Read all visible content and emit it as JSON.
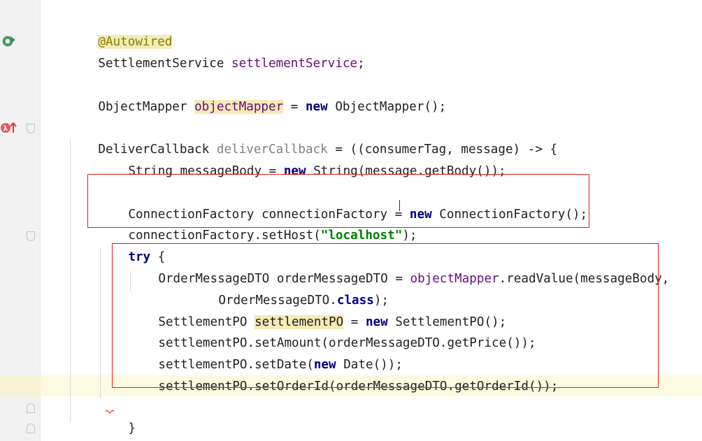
{
  "editor": {
    "line1": {
      "t0": "@Autowired"
    },
    "line2": {
      "t0": "SettlementService ",
      "t1": "settlementService",
      "t2": ";"
    },
    "line4": {
      "t0": "ObjectMapper ",
      "t1": "objectMapper",
      "t2": " = ",
      "t3": "new",
      "t4": " ObjectMapper();"
    },
    "line6": {
      "t0": "DeliverCallback ",
      "t1": "deliverCallback",
      "t2": " = ((consumerTag, message) -> {"
    },
    "line7": {
      "t0": "String messageBody = ",
      "t1": "new",
      "t2": " String(message.getBody());"
    },
    "line9": {
      "t0": "ConnectionFactory connectionFactory = ",
      "t1": "new",
      "t2": " ConnectionFactory();"
    },
    "line10": {
      "t0": "connectionFactory.setHost(",
      "t1": "\"localhost\"",
      "t2": ");"
    },
    "line11": {
      "t0": "try",
      "t1": " {"
    },
    "line12": {
      "t0": "OrderMessageDTO orderMessageDTO = ",
      "t1": "objectMapper",
      "t2": ".readValue(messageBody,"
    },
    "line13": {
      "t0": "OrderMessageDTO.",
      "t1": "class",
      "t2": ");"
    },
    "line14": {
      "t0": "SettlementPO ",
      "t1": "settlementPO",
      "t2": " = ",
      "t3": "new",
      "t4": " SettlementPO();"
    },
    "line15": {
      "t0": "settlementPO.setAmount(orderMessageDTO.getPrice());"
    },
    "line16": {
      "t0": "settlementPO.setDate(",
      "t1": "new",
      "t2": " Date());"
    },
    "line17": {
      "t0": "settlementPO.setOrderId(orderMessageDTO.getOrderId());"
    },
    "line19": {
      "t0": "}"
    },
    "line20": {
      "t0": "});"
    }
  },
  "gutter": {
    "icons": [
      "bean-injection-icon",
      "lambda-override-icon"
    ]
  },
  "colors": {
    "keyword": "#000080",
    "field": "#660e7a",
    "unused": "#808080",
    "annotation": "#808000",
    "string": "#008000",
    "highlight": "#f5eab8",
    "current_line": "#fcfae1",
    "annotation_box": "#e02020"
  }
}
